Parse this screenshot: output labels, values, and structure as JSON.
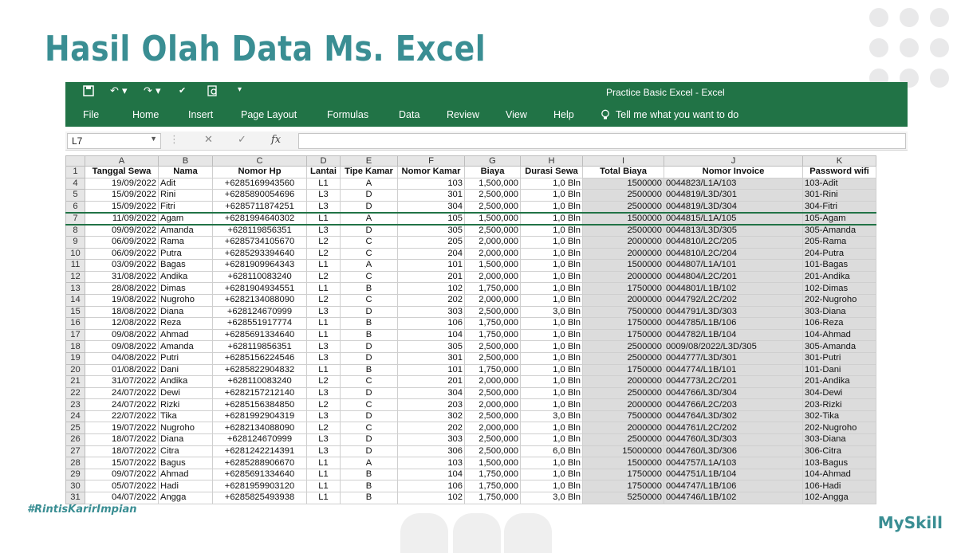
{
  "slide": {
    "title": "Hasil Olah Data Ms. Excel",
    "hashtag": "#RintisKarirImpian",
    "brand": "MySkill"
  },
  "window": {
    "title": "Practice Basic Excel  -  Excel"
  },
  "menu": [
    "File",
    "Home",
    "Insert",
    "Page Layout",
    "Formulas",
    "Data",
    "Review",
    "View",
    "Help"
  ],
  "tell_me": "Tell me what you want to do",
  "name_box": "L7",
  "columns": [
    "A",
    "B",
    "C",
    "D",
    "E",
    "F",
    "G",
    "H",
    "I",
    "J",
    "K"
  ],
  "headers": [
    "Tanggal Sewa",
    "Nama",
    "Nomor Hp",
    "Lantai",
    "Tipe Kamar",
    "Nomor Kamar",
    "Biaya",
    "Durasi Sewa",
    "Total Biaya",
    "Nomor Invoice",
    "Password wifi"
  ],
  "rows": [
    {
      "n": "4",
      "cells": [
        "19/09/2022",
        "Adit",
        "+6285169943560",
        "L1",
        "A",
        "103",
        "1,500,000",
        "1,0 Bln",
        "1500000",
        "0044823/L1A/103",
        "103-Adit"
      ]
    },
    {
      "n": "5",
      "cells": [
        "15/09/2022",
        "Rini",
        "+6285890054696",
        "L3",
        "D",
        "301",
        "2,500,000",
        "1,0 Bln",
        "2500000",
        "0044819/L3D/301",
        "301-Rini"
      ]
    },
    {
      "n": "6",
      "cells": [
        "15/09/2022",
        "Fitri",
        "+6285711874251",
        "L3",
        "D",
        "304",
        "2,500,000",
        "1,0 Bln",
        "2500000",
        "0044819/L3D/304",
        "304-Fitri"
      ]
    },
    {
      "n": "7",
      "cells": [
        "11/09/2022",
        "Agam",
        "+6281994640302",
        "L1",
        "A",
        "105",
        "1,500,000",
        "1,0 Bln",
        "1500000",
        "0044815/L1A/105",
        "105-Agam"
      ]
    },
    {
      "n": "8",
      "cells": [
        "09/09/2022",
        "Amanda",
        "+628119856351",
        "L3",
        "D",
        "305",
        "2,500,000",
        "1,0 Bln",
        "2500000",
        "0044813/L3D/305",
        "305-Amanda"
      ]
    },
    {
      "n": "9",
      "cells": [
        "06/09/2022",
        "Rama",
        "+6285734105670",
        "L2",
        "C",
        "205",
        "2,000,000",
        "1,0 Bln",
        "2000000",
        "0044810/L2C/205",
        "205-Rama"
      ]
    },
    {
      "n": "10",
      "cells": [
        "06/09/2022",
        "Putra",
        "+6285293394640",
        "L2",
        "C",
        "204",
        "2,000,000",
        "1,0 Bln",
        "2000000",
        "0044810/L2C/204",
        "204-Putra"
      ]
    },
    {
      "n": "11",
      "cells": [
        "03/09/2022",
        "Bagas",
        "+6281909964343",
        "L1",
        "A",
        "101",
        "1,500,000",
        "1,0 Bln",
        "1500000",
        "0044807/L1A/101",
        "101-Bagas"
      ]
    },
    {
      "n": "12",
      "cells": [
        "31/08/2022",
        "Andika",
        "+628110083240",
        "L2",
        "C",
        "201",
        "2,000,000",
        "1,0 Bln",
        "2000000",
        "0044804/L2C/201",
        "201-Andika"
      ]
    },
    {
      "n": "13",
      "cells": [
        "28/08/2022",
        "Dimas",
        "+6281904934551",
        "L1",
        "B",
        "102",
        "1,750,000",
        "1,0 Bln",
        "1750000",
        "0044801/L1B/102",
        "102-Dimas"
      ]
    },
    {
      "n": "14",
      "cells": [
        "19/08/2022",
        "Nugroho",
        "+6282134088090",
        "L2",
        "C",
        "202",
        "2,000,000",
        "1,0 Bln",
        "2000000",
        "0044792/L2C/202",
        "202-Nugroho"
      ]
    },
    {
      "n": "15",
      "cells": [
        "18/08/2022",
        "Diana",
        "+628124670999",
        "L3",
        "D",
        "303",
        "2,500,000",
        "3,0 Bln",
        "7500000",
        "0044791/L3D/303",
        "303-Diana"
      ]
    },
    {
      "n": "16",
      "cells": [
        "12/08/2022",
        "Reza",
        "+628551917774",
        "L1",
        "B",
        "106",
        "1,750,000",
        "1,0 Bln",
        "1750000",
        "0044785/L1B/106",
        "106-Reza"
      ]
    },
    {
      "n": "17",
      "cells": [
        "09/08/2022",
        "Ahmad",
        "+6285691334640",
        "L1",
        "B",
        "104",
        "1,750,000",
        "1,0 Bln",
        "1750000",
        "0044782/L1B/104",
        "104-Ahmad"
      ]
    },
    {
      "n": "18",
      "cells": [
        "09/08/2022",
        "Amanda",
        "+628119856351",
        "L3",
        "D",
        "305",
        "2,500,000",
        "1,0 Bln",
        "2500000",
        "0009/08/2022/L3D/305",
        "305-Amanda"
      ]
    },
    {
      "n": "19",
      "cells": [
        "04/08/2022",
        "Putri",
        "+6285156224546",
        "L3",
        "D",
        "301",
        "2,500,000",
        "1,0 Bln",
        "2500000",
        "0044777/L3D/301",
        "301-Putri"
      ]
    },
    {
      "n": "20",
      "cells": [
        "01/08/2022",
        "Dani",
        "+6285822904832",
        "L1",
        "B",
        "101",
        "1,750,000",
        "1,0 Bln",
        "1750000",
        "0044774/L1B/101",
        "101-Dani"
      ]
    },
    {
      "n": "21",
      "cells": [
        "31/07/2022",
        "Andika",
        "+628110083240",
        "L2",
        "C",
        "201",
        "2,000,000",
        "1,0 Bln",
        "2000000",
        "0044773/L2C/201",
        "201-Andika"
      ]
    },
    {
      "n": "22",
      "cells": [
        "24/07/2022",
        "Dewi",
        "+6282157212140",
        "L3",
        "D",
        "304",
        "2,500,000",
        "1,0 Bln",
        "2500000",
        "0044766/L3D/304",
        "304-Dewi"
      ]
    },
    {
      "n": "23",
      "cells": [
        "24/07/2022",
        "Rizki",
        "+6285156384850",
        "L2",
        "C",
        "203",
        "2,000,000",
        "1,0 Bln",
        "2000000",
        "0044766/L2C/203",
        "203-Rizki"
      ]
    },
    {
      "n": "24",
      "cells": [
        "22/07/2022",
        "Tika",
        "+6281992904319",
        "L3",
        "D",
        "302",
        "2,500,000",
        "3,0 Bln",
        "7500000",
        "0044764/L3D/302",
        "302-Tika"
      ]
    },
    {
      "n": "25",
      "cells": [
        "19/07/2022",
        "Nugroho",
        "+6282134088090",
        "L2",
        "C",
        "202",
        "2,000,000",
        "1,0 Bln",
        "2000000",
        "0044761/L2C/202",
        "202-Nugroho"
      ]
    },
    {
      "n": "26",
      "cells": [
        "18/07/2022",
        "Diana",
        "+628124670999",
        "L3",
        "D",
        "303",
        "2,500,000",
        "1,0 Bln",
        "2500000",
        "0044760/L3D/303",
        "303-Diana"
      ]
    },
    {
      "n": "27",
      "cells": [
        "18/07/2022",
        "Citra",
        "+6281242214391",
        "L3",
        "D",
        "306",
        "2,500,000",
        "6,0 Bln",
        "15000000",
        "0044760/L3D/306",
        "306-Citra"
      ]
    },
    {
      "n": "28",
      "cells": [
        "15/07/2022",
        "Bagus",
        "+6285288906670",
        "L1",
        "A",
        "103",
        "1,500,000",
        "1,0 Bln",
        "1500000",
        "0044757/L1A/103",
        "103-Bagus"
      ]
    },
    {
      "n": "29",
      "cells": [
        "09/07/2022",
        "Ahmad",
        "+6285691334640",
        "L1",
        "B",
        "104",
        "1,750,000",
        "1,0 Bln",
        "1750000",
        "0044751/L1B/104",
        "104-Ahmad"
      ]
    },
    {
      "n": "30",
      "cells": [
        "05/07/2022",
        "Hadi",
        "+6281959903120",
        "L1",
        "B",
        "106",
        "1,750,000",
        "1,0 Bln",
        "1750000",
        "0044747/L1B/106",
        "106-Hadi"
      ]
    },
    {
      "n": "31",
      "cells": [
        "04/07/2022",
        "Angga",
        "+6285825493938",
        "L1",
        "B",
        "102",
        "1,750,000",
        "3,0 Bln",
        "5250000",
        "0044746/L1B/102",
        "102-Angga"
      ]
    }
  ],
  "colors": {
    "accent": "#3a8e93",
    "ribbon": "#217346",
    "shade": "#dcdcdc"
  },
  "icons": [
    "save-icon",
    "undo-icon",
    "redo-icon",
    "spelling-icon",
    "print-preview-icon",
    "customize-icon",
    "lightbulb-icon"
  ]
}
